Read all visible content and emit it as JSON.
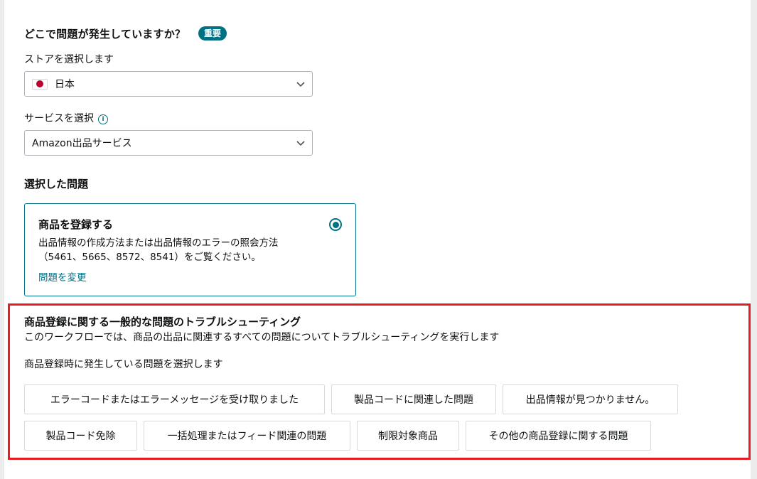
{
  "question": {
    "title": "どこで問題が発生していますか？",
    "badge": "重要"
  },
  "store": {
    "label": "ストアを選択します",
    "selected": "日本",
    "flag_icon": "japan-flag-icon"
  },
  "service": {
    "label": "サービスを選択",
    "selected": "Amazon出品サービス"
  },
  "selected_issue": {
    "section_title": "選択した問題",
    "title": "商品を登録する",
    "description_line1": "出品情報の作成方法または出品情報のエラーの照会方法",
    "description_line2": "（5461、5665、8572、8541）をご覧ください。",
    "change_link": "問題を変更"
  },
  "troubleshoot": {
    "title": "商品登録に関する一般的な問題のトラブルシューティング",
    "description": "このワークフローでは、商品の出品に関連するすべての問題についてトラブルシューティングを実行します",
    "prompt": "商品登録時に発生している問題を選択します",
    "options": [
      "エラーコードまたはエラーメッセージを受け取りました",
      "製品コードに関連した問題",
      "出品情報が見つかりません。",
      "製品コード免除",
      "一括処理またはフィード関連の問題",
      "制限対象商品",
      "その他の商品登録に関する問題"
    ]
  },
  "colors": {
    "accent": "#007185",
    "highlight_border": "#e31e24",
    "flag_red": "#bc002d"
  }
}
